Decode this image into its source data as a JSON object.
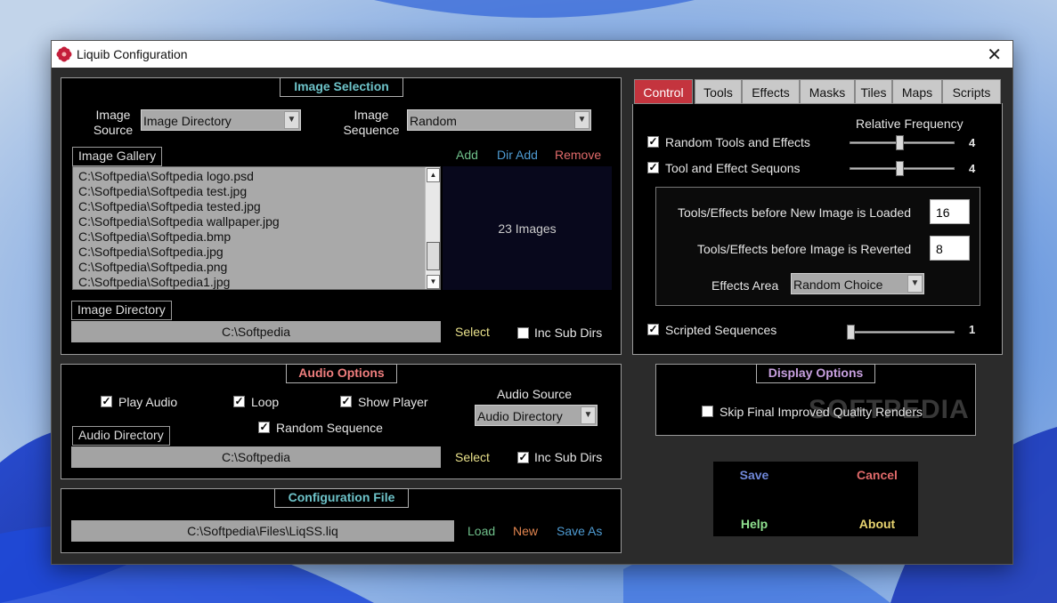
{
  "window": {
    "title": "Liquib Configuration"
  },
  "image_selection": {
    "heading": "Image Selection",
    "image_source_label": "Image Source",
    "image_source_line1": "Image",
    "image_source_line2": "Source",
    "image_source_value": "Image Directory",
    "image_sequence_line1": "Image",
    "image_sequence_line2": "Sequence",
    "image_sequence_value": "Random",
    "gallery_label": "Image Gallery",
    "add": "Add",
    "dir_add": "Dir Add",
    "remove": "Remove",
    "gallery_items": [
      "C:\\Softpedia\\Softpedia logo.psd",
      "C:\\Softpedia\\Softpedia test.jpg",
      "C:\\Softpedia\\Softpedia tested.jpg",
      "C:\\Softpedia\\Softpedia wallpaper.jpg",
      "C:\\Softpedia\\Softpedia.bmp",
      "C:\\Softpedia\\Softpedia.jpg",
      "C:\\Softpedia\\Softpedia.png",
      "C:\\Softpedia\\Softpedia1.jpg"
    ],
    "image_count": "23 Images",
    "directory_label": "Image Directory",
    "directory_value": "C:\\Softpedia",
    "select": "Select",
    "inc_sub_dirs": "Inc Sub Dirs"
  },
  "audio_options": {
    "heading": "Audio Options",
    "play_audio": "Play Audio",
    "loop": "Loop",
    "show_player": "Show Player",
    "random_sequence": "Random Sequence",
    "audio_source_label": "Audio Source",
    "audio_source_value": "Audio Directory",
    "directory_label": "Audio Directory",
    "directory_value": "C:\\Softpedia",
    "select": "Select",
    "inc_sub_dirs": "Inc Sub Dirs"
  },
  "config_file": {
    "heading": "Configuration File",
    "path": "C:\\Softpedia\\Files\\LiqSS.liq",
    "load": "Load",
    "new": "New",
    "save_as": "Save As"
  },
  "tabs": [
    "Control",
    "Tools",
    "Effects",
    "Masks",
    "Tiles",
    "Maps",
    "Scripts"
  ],
  "control": {
    "relative_frequency": "Relative Frequency",
    "random_tools": "Random Tools and Effects",
    "random_tools_value": "4",
    "random_tools_level": 0.48,
    "tool_sequences": "Tool and Effect Sequons",
    "tool_sequences_value": "4",
    "tool_sequences_level": 0.48,
    "before_new_label": "Tools/Effects before New Image is Loaded",
    "before_new_value": "16",
    "before_revert_label": "Tools/Effects before Image is Reverted",
    "before_revert_value": "8",
    "effects_area_label": "Effects Area",
    "effects_area_value": "Random Choice",
    "scripted": "Scripted Sequences",
    "scripted_value": "1",
    "scripted_level": 0.0
  },
  "display_options": {
    "heading": "Display Options",
    "skip_final": "Skip Final Improved Quality Renders"
  },
  "buttons": {
    "save": "Save",
    "cancel": "Cancel",
    "help": "Help",
    "about": "About"
  },
  "watermark": "SOFTPEDIA",
  "colors": {
    "accent_cyan": "#6ec3c9",
    "add_green": "#6fbf8a",
    "dir_add_blue": "#4e9bd2",
    "remove_red": "#e06a6a",
    "select_yellow": "#e8e08a",
    "audio_heading_red": "#ef7e7e",
    "display_heading_purple": "#c8a0e0",
    "tab_active": "#c4343e"
  }
}
